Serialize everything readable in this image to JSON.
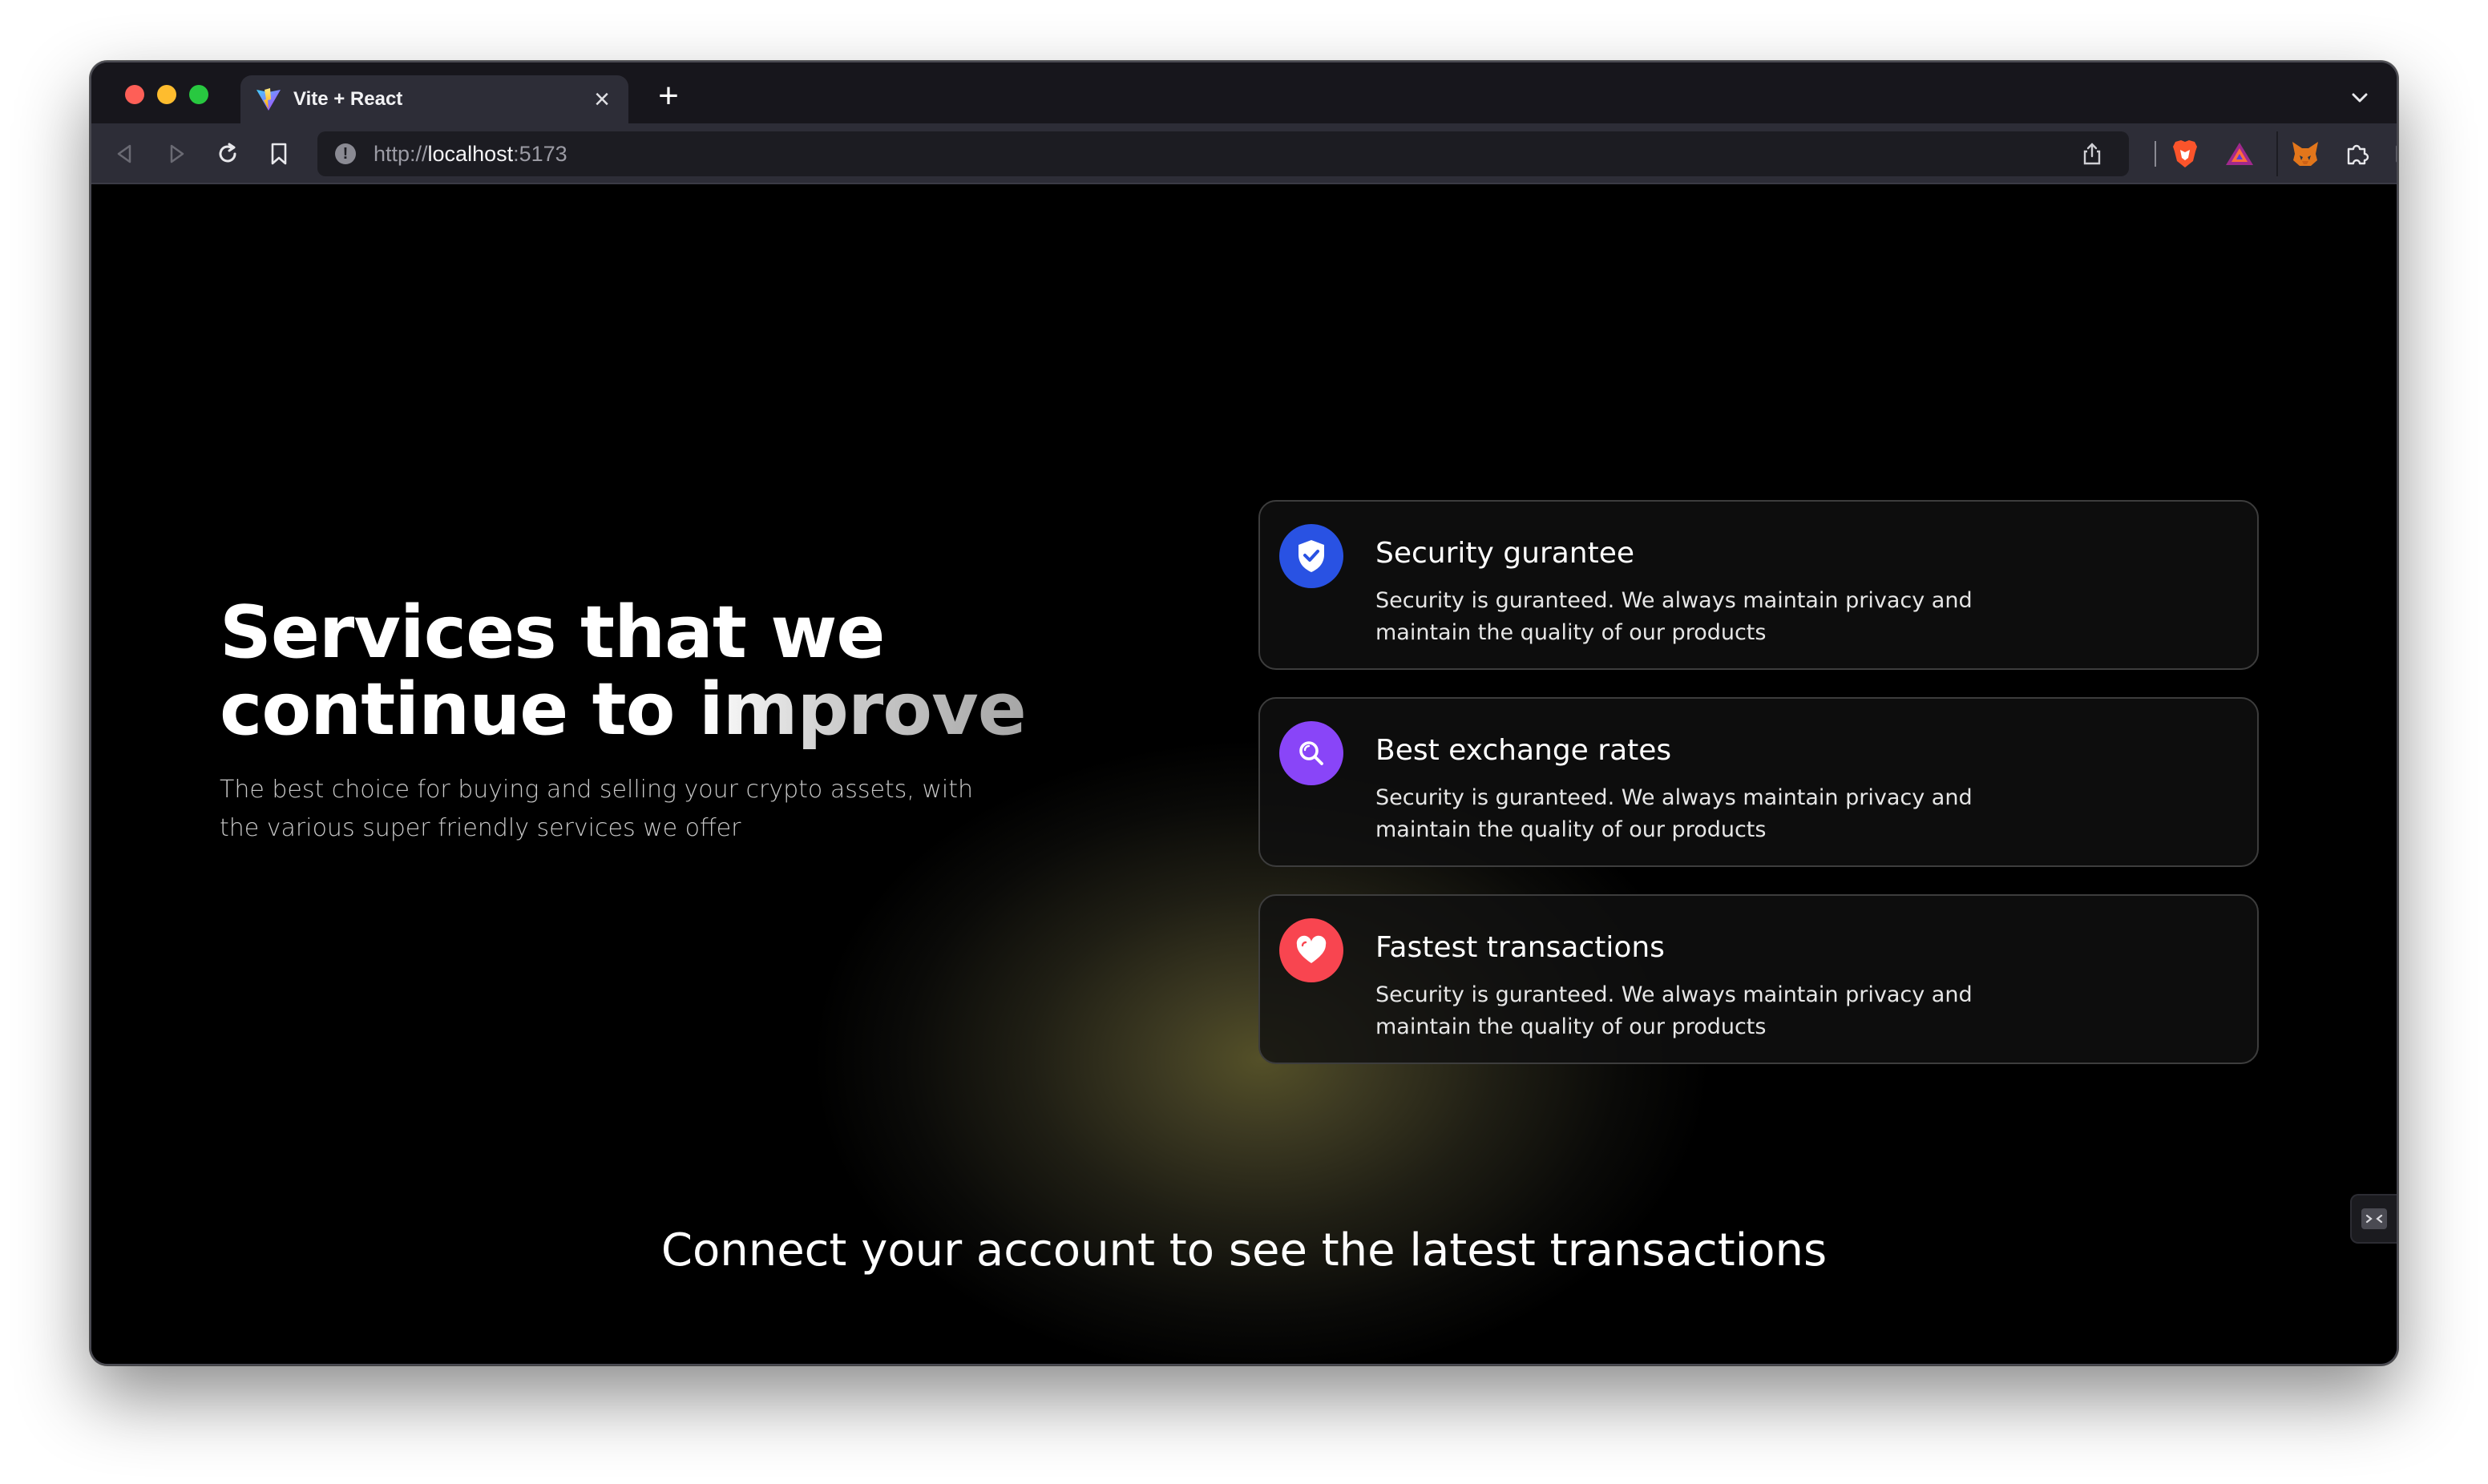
{
  "browser": {
    "tab": {
      "title": "Vite + React",
      "close_glyph": "×"
    },
    "new_tab_glyph": "+",
    "url": {
      "scheme": "http://",
      "host": "localhost",
      "port": ":5173"
    },
    "traffic_light_colors": [
      "#fe5f57",
      "#febc2e",
      "#28c840"
    ]
  },
  "hero": {
    "title_line1": "Services that we",
    "title_line2_start": "continue to ",
    "title_line2_fade": "improve",
    "subtitle": "The best choice for buying and selling your crypto assets, with the various super friendly services we offer"
  },
  "services": [
    {
      "icon": "shield-check-icon",
      "color": "#2952e3",
      "title": "Security gurantee",
      "desc": "Security is guranteed. We always maintain privacy and maintain the quality of our products"
    },
    {
      "icon": "search-icon",
      "color": "#8945f8",
      "title": "Best exchange rates",
      "desc": "Security is guranteed. We always maintain privacy and maintain the quality of our products"
    },
    {
      "icon": "heart-icon",
      "color": "#f84550",
      "title": "Fastest transactions",
      "desc": "Security is guranteed. We always maintain privacy and maintain the quality of our products"
    }
  ],
  "transactions": {
    "connect_message": "Connect your account to see the latest transactions"
  }
}
